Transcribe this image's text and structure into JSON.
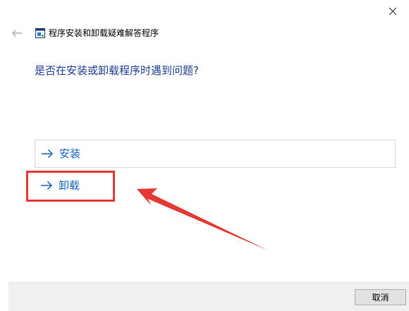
{
  "window": {
    "title": "程序安装和卸载疑难解答程序",
    "close_icon": "close-icon",
    "back_icon": "back-arrow-icon",
    "app_icon": "troubleshooter-app-icon"
  },
  "main": {
    "question": "是否在安装或卸载程序时遇到问题?",
    "options": [
      {
        "label": "安装",
        "icon": "arrow-right-icon"
      },
      {
        "label": "卸载",
        "icon": "arrow-right-icon"
      }
    ]
  },
  "footer": {
    "cancel_label": "取消"
  },
  "annotation": {
    "highlight_color": "#e53935",
    "arrow_color": "#e53935"
  },
  "colors": {
    "question_text": "#1f3f8f",
    "link_text": "#1565c0",
    "option_border": "#cfd8e3",
    "footer_bg": "#f0f0f0"
  }
}
